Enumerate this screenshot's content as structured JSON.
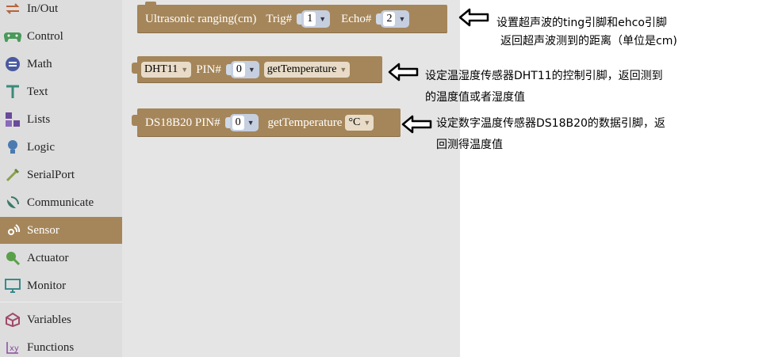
{
  "sidebar": {
    "items": [
      {
        "label": "In/Out",
        "icon": "in-out-icon"
      },
      {
        "label": "Control",
        "icon": "gamepad-icon"
      },
      {
        "label": "Math",
        "icon": "math-icon"
      },
      {
        "label": "Text",
        "icon": "text-icon"
      },
      {
        "label": "Lists",
        "icon": "lists-icon"
      },
      {
        "label": "Logic",
        "icon": "logic-bulb-icon"
      },
      {
        "label": "SerialPort",
        "icon": "serial-port-icon"
      },
      {
        "label": "Communicate",
        "icon": "satellite-icon"
      },
      {
        "label": "Sensor",
        "icon": "sensor-icon",
        "selected": true
      },
      {
        "label": "Actuator",
        "icon": "actuator-icon"
      },
      {
        "label": "Monitor",
        "icon": "monitor-icon"
      },
      {
        "label": "Variables",
        "icon": "variables-icon"
      },
      {
        "label": "Functions",
        "icon": "functions-icon"
      }
    ]
  },
  "blocks": {
    "ultrasonic": {
      "title": "Ultrasonic ranging(cm)",
      "trig_label": "Trig#",
      "trig_value": "1",
      "echo_label": "Echo#",
      "echo_value": "2"
    },
    "dht11": {
      "sensor": "DHT11",
      "pin_label": "PIN#",
      "pin_value": "0",
      "mode": "getTemperature"
    },
    "ds18b20": {
      "title": "DS18B20 PIN#",
      "pin_value": "0",
      "mode_label": "getTemperature",
      "unit": "°C"
    }
  },
  "notes": {
    "ultrasonic_line1": "设置超声波的ting引脚和ehco引脚",
    "ultrasonic_line2": "返回超声波测到的距离（单位是cm)",
    "dht11_line1": "设定温湿度传感器DHT11的控制引脚，返回测到",
    "dht11_line2": "的温度值或者湿度值",
    "ds18b20_line1": "设定数字温度传感器DS18B20的数据引脚，返",
    "ds18b20_line2": "回测得温度值"
  },
  "colors": {
    "block": "#a5865a",
    "sidebar": "#dddddd",
    "workspace": "#e5e5e5",
    "selected": "#a5865a"
  }
}
